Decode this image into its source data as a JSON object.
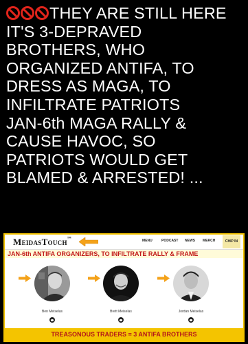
{
  "post": {
    "lines": [
      "THEY ARE STILL HERE",
      "IT'S 3-DEPRAVED",
      "BROTHERS, WHO",
      "ORGANIZED ANTIFA, TO",
      "DRESS AS MAGA, TO",
      "INFILTRATE PATRIOTS",
      "JAN-6th MAGA RALLY &",
      "CAUSE HAVOC,  SO",
      "PATRIOTS WOULD GET",
      "BLAMED & ARRESTED!  ..."
    ],
    "leading_emoji": "no-entry-sign-icon",
    "emoji_count": 3
  },
  "card": {
    "logo": "MeidasTouch",
    "logo_tm": "™",
    "nav": [
      "MENU",
      "PODCAST",
      "NEWS",
      "MERCH",
      "CHIP IN"
    ],
    "headline": "JAN-6th ANTIFA ORGANIZERS, TO INFILTRATE RALLY  & FRAME",
    "people": [
      {
        "name": "Ben Meiselas"
      },
      {
        "name": "Brett Meiselas"
      },
      {
        "name": "Jordan Meiselas"
      }
    ],
    "footer": "TREASONOUS TRADERS = 3 ANTIFA BROTHERS"
  },
  "colors": {
    "background": "#000000",
    "text": "#ffffff",
    "emoji_red": "#e0241b",
    "accent_yellow": "#f4c400",
    "headline_red": "#c21b1b",
    "arrow_orange": "#f4a21a"
  }
}
